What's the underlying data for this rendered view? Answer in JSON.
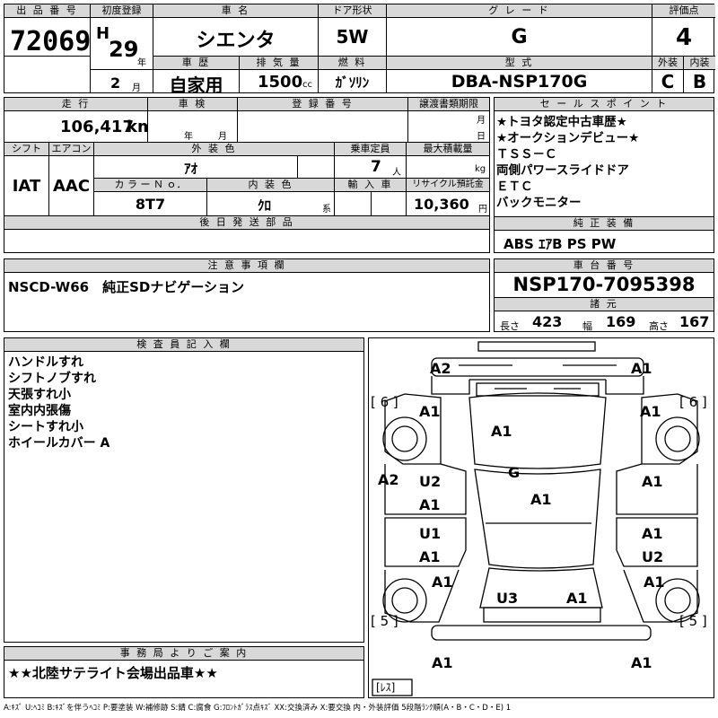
{
  "header": {
    "lot_label": "出 品 番 号",
    "lot_no": "72069",
    "first_reg_label": "初度登録",
    "era": "H",
    "year": "29",
    "year_unit": "年",
    "month": "2",
    "month_unit": "月",
    "name_label": "車 名",
    "car_name": "シエンタ",
    "door_label": "ドア形状",
    "door": "5W",
    "grade_label": "グ レ ー ド",
    "grade": "G",
    "score_label": "評価点",
    "score": "4",
    "history_label": "車 歴",
    "history": "自家用",
    "disp_label": "排 気 量",
    "disp": "1500",
    "disp_unit": "cc",
    "fuel_label": "燃 料",
    "fuel": "ｶﾞｿﾘﾝ",
    "model_label": "型 式",
    "model": "DBA-NSP170G",
    "ext_label": "外装",
    "int_label": "内装",
    "ext_grade": "C",
    "int_grade": "B"
  },
  "row2": {
    "mileage_label": "走 行",
    "mileage": "106,417",
    "mileage_unit": "km",
    "inspection_label": "車 検",
    "insp_year_unit": "年",
    "insp_month_unit": "月",
    "plate_label": "登 録 番 号",
    "transfer_label": "譲渡書類期限",
    "transfer_month_unit": "月",
    "transfer_day_unit": "日",
    "shift_label": "シフト",
    "shift": "IAT",
    "ac_label": "エアコン",
    "ac": "AAC",
    "color_label": "外 装 色",
    "color": "ｱｵ",
    "capacity_label": "乗車定員",
    "capacity": "7",
    "capacity_unit": "人",
    "load_label": "最大積載量",
    "load_unit": "kg",
    "color_no_label": "カ ラ ー Ｎ ｏ．",
    "color_no": "8T7",
    "int_color_label": "内 装 色",
    "int_color": "ｸﾛ",
    "int_color_unit": "系",
    "import_label": "輸 入 車",
    "recycle_label": "リサイクル預託金",
    "recycle": "10,360",
    "recycle_unit": "円",
    "later_label": "後 日 発 送 部 品"
  },
  "sales": {
    "label": "セ ー ル ス ポ イ ン ト",
    "points": [
      "★トヨタ認定中古車歴★",
      "★オークションデビュー★",
      "ＴＳＳ－Ｃ",
      "両側パワースライドドア",
      "ＥＴＣ",
      "バックモニター"
    ],
    "equip_label": "純 正 装 備",
    "equip": "ABS ｴｱB PS PW"
  },
  "notes": {
    "label": "注 意 事 項 欄",
    "text": "NSCD-W66　純正SDナビゲーション"
  },
  "chassis": {
    "label": "車 台 番 号",
    "number": "NSP170-7095398",
    "dims_label": "諸 元",
    "length_label": "長さ",
    "length": "423",
    "width_label": "幅",
    "width": "169",
    "height_label": "高さ",
    "height": "167"
  },
  "inspector": {
    "label": "検 査 員 記 入 欄",
    "items": [
      "ハンドルすれ",
      "シフトノブすれ",
      "天張すれ小",
      "室内内張傷",
      "シートすれ小",
      "ホイールカバー A"
    ]
  },
  "office": {
    "label": "事 務 局 よ り ご 案 内",
    "text": "★★北陸サテライト会場出品車★★"
  },
  "diagram": {
    "marks": [
      "A2",
      "A1",
      "A1",
      "A1",
      "A1",
      "A2",
      "U2",
      "A1",
      "G",
      "A1",
      "A1",
      "U1",
      "A1",
      "A1",
      "U2",
      "A1",
      "A1",
      "U3",
      "A1",
      "A1",
      "A1"
    ],
    "tires": [
      "[ 6 ]",
      "[ 6 ]",
      "[ 5 ]",
      "[ 5 ]"
    ],
    "spare": "[ﾚｽ]"
  },
  "legend": "A:ｷｽﾞ U:ﾍｺﾐ B:ｷｽﾞを伴うﾍｺﾐ P:要塗装 W:補修跡 S:錆 C:腐食 G:ﾌﾛﾝﾄｶﾞﾗｽ点ｷｽﾞ XX:交換済み X:要交換 内・外装評価 5段階ﾗﾝｸ順(A・B・C・D・E) 1"
}
